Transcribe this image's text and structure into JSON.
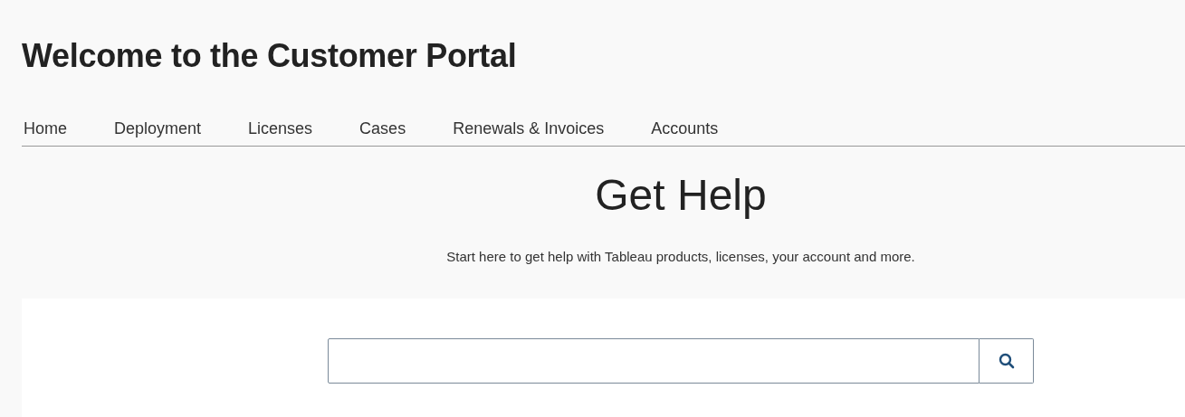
{
  "page": {
    "title": "Welcome to the Customer Portal"
  },
  "nav": [
    {
      "label": "Home"
    },
    {
      "label": "Deployment"
    },
    {
      "label": "Licenses"
    },
    {
      "label": "Cases"
    },
    {
      "label": "Renewals & Invoices"
    },
    {
      "label": "Accounts"
    }
  ],
  "help": {
    "heading": "Get Help",
    "subtitle": "Start here to get help with Tableau products, licenses, your account and more."
  }
}
